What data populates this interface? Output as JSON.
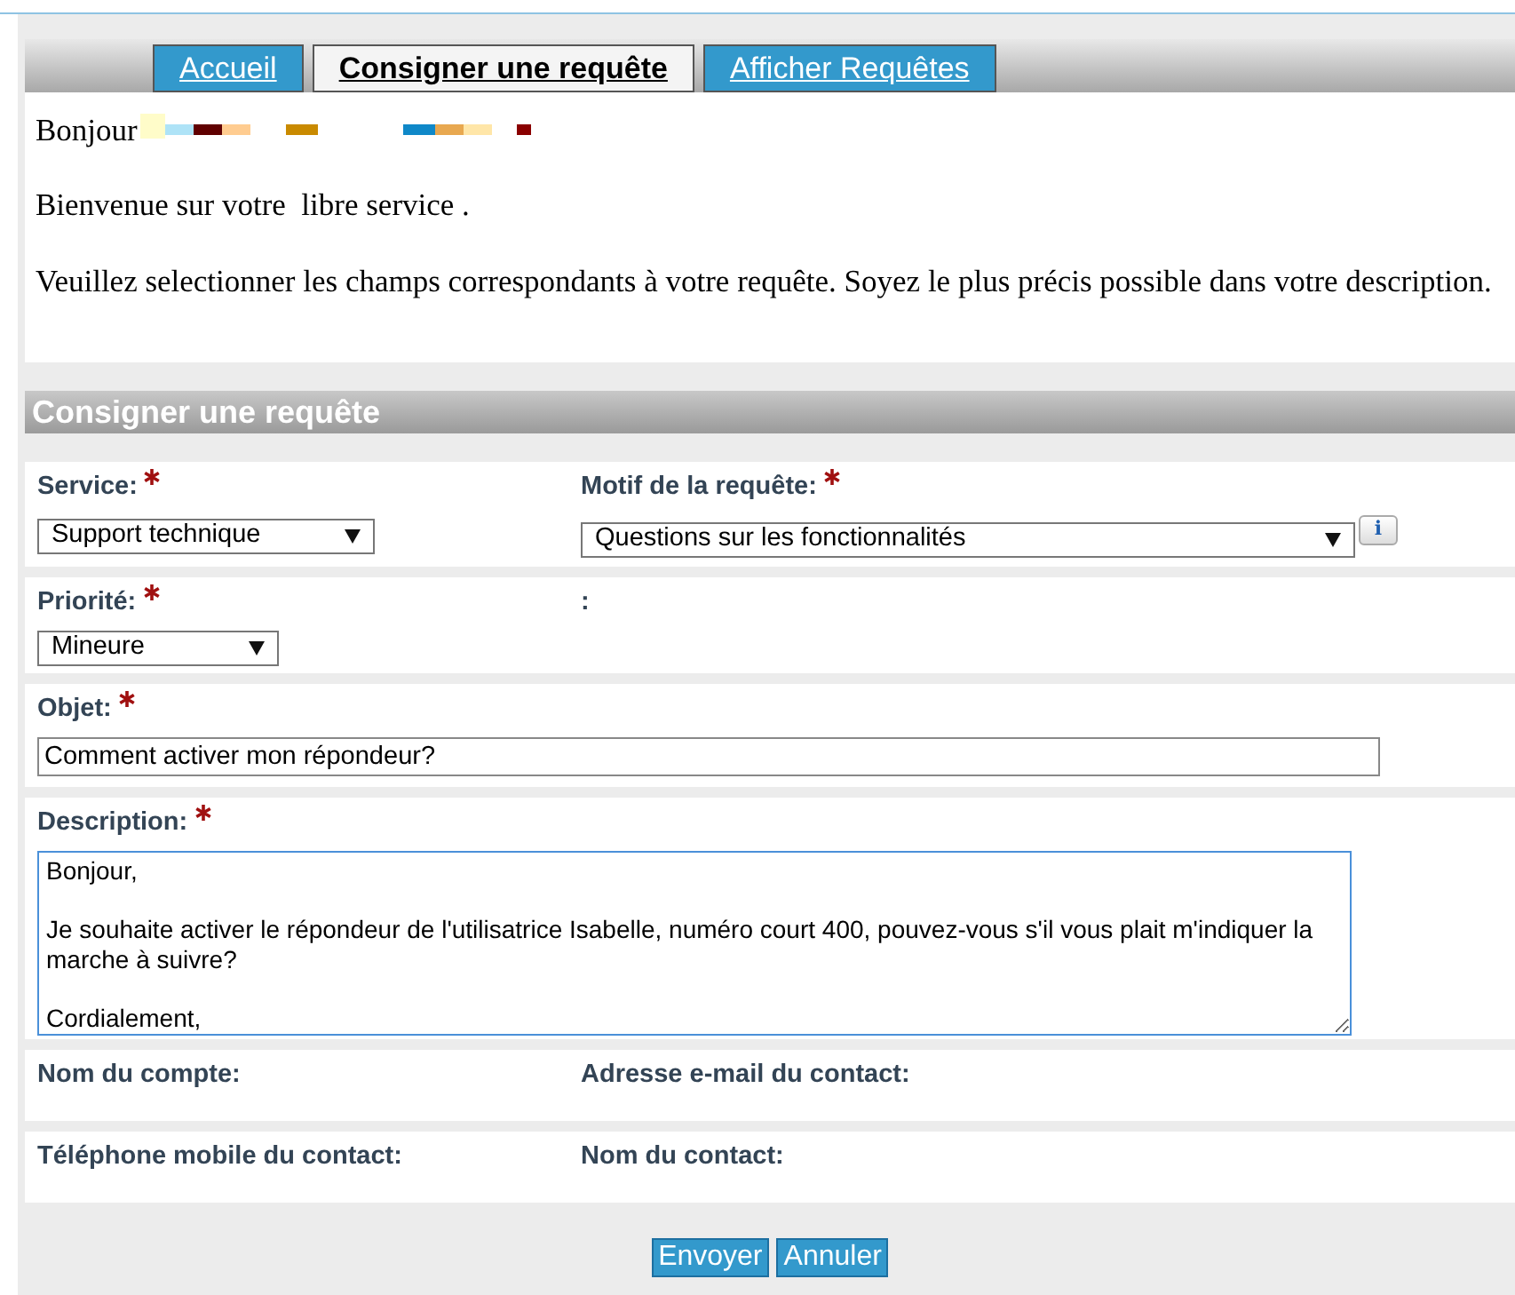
{
  "tabs": [
    {
      "label": "Accueil",
      "selected": false
    },
    {
      "label": "Consigner une requête",
      "selected": true
    },
    {
      "label": "Afficher Requêtes",
      "selected": false
    }
  ],
  "greeting": "Bonjour",
  "welcome": "Bienvenue sur votre  libre service .",
  "instructions": "Veuillez selectionner les champs correspondants à votre requête. Soyez le plus précis possible dans votre description.",
  "section_title": "Consigner une requête",
  "service": {
    "label": "Service:",
    "required": true,
    "value": "Support technique"
  },
  "motif": {
    "label": "Motif de la requête:",
    "required": true,
    "value": "Questions sur les fonctionnalités"
  },
  "priorite": {
    "label": "Priorité:",
    "required": true,
    "value": "Mineure"
  },
  "colon_label": ":",
  "info_button": "i",
  "objet": {
    "label": "Objet:",
    "required": true,
    "value": "Comment activer mon répondeur?"
  },
  "description": {
    "label": "Description:",
    "required": true,
    "value": "Bonjour,\n\nJe souhaite activer le répondeur de l'utilisatrice Isabelle, numéro court 400, pouvez-vous s'il vous plait m'indiquer la marche à suivre?\n\nCordialement,"
  },
  "contact_fields": [
    {
      "label": "Nom du compte:"
    },
    {
      "label": "Adresse e-mail du contact:"
    },
    {
      "label": "Téléphone mobile du contact:"
    },
    {
      "label": "Nom du contact:"
    }
  ],
  "buttons": [
    "Envoyer",
    "Annuler"
  ]
}
